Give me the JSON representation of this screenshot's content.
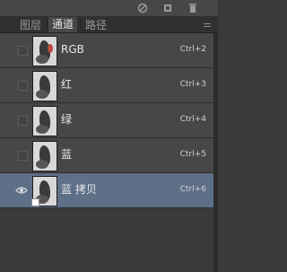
{
  "toolbar": {
    "icons": [
      "no-icon",
      "new-channel-icon",
      "delete-icon"
    ]
  },
  "tabs": [
    {
      "label": "图层",
      "active": false
    },
    {
      "label": "通道",
      "active": true
    },
    {
      "label": "路径",
      "active": false
    }
  ],
  "channels": [
    {
      "label": "RGB",
      "shortcut": "Ctrl+2",
      "visible": false,
      "selected": false
    },
    {
      "label": "红",
      "shortcut": "Ctrl+3",
      "visible": false,
      "selected": false
    },
    {
      "label": "绿",
      "shortcut": "Ctrl+4",
      "visible": false,
      "selected": false
    },
    {
      "label": "蓝",
      "shortcut": "Ctrl+5",
      "visible": false,
      "selected": false
    },
    {
      "label": "蓝 拷贝",
      "shortcut": "Ctrl+6",
      "visible": true,
      "selected": true
    }
  ],
  "colors": {
    "panel": "#474747",
    "selected": "#5e6f88",
    "background": "#3a3a3a"
  }
}
